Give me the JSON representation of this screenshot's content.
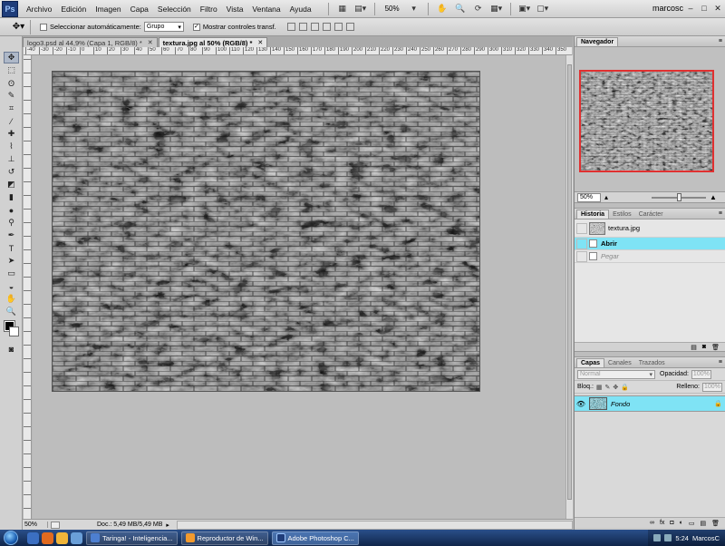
{
  "menu": [
    "Archivo",
    "Edición",
    "Imagen",
    "Capa",
    "Selección",
    "Filtro",
    "Vista",
    "Ventana",
    "Ayuda"
  ],
  "menubar": {
    "zoom": "50%",
    "user": "marcosc"
  },
  "options": {
    "auto_select_label": "Seleccionar automáticamente:",
    "auto_select_value": "Grupo",
    "transform_check": "✓",
    "transform_label": "Mostrar controles transf."
  },
  "tabs": [
    {
      "label": "logo3.psd al 44,9% (Capa 1, RGB/8) *",
      "active": false
    },
    {
      "label": "textura.jpg al 50% (RGB/8) *",
      "active": true
    }
  ],
  "ruler_labels": [
    "-40",
    "-30",
    "-20",
    "-10",
    "0",
    "10",
    "20",
    "30",
    "40",
    "50",
    "60",
    "70",
    "80",
    "90",
    "100",
    "110",
    "120",
    "130",
    "140",
    "150",
    "160",
    "170",
    "180",
    "190",
    "200",
    "210",
    "220",
    "230",
    "240",
    "250",
    "260",
    "270",
    "280",
    "290",
    "300",
    "310",
    "320",
    "330",
    "340",
    "350"
  ],
  "status": {
    "zoom": "50%",
    "doc": "Doc.: 5,49 MB/5,49 MB"
  },
  "navigator": {
    "tab": "Navegador",
    "zoom": "50%"
  },
  "history": {
    "tabs": [
      "Historia",
      "Estilos",
      "Carácter"
    ],
    "snapshot": "textura.jpg",
    "steps": [
      {
        "label": "Abrir",
        "state": "selected"
      },
      {
        "label": "Pegar",
        "state": "undone"
      }
    ]
  },
  "layers": {
    "tabs": [
      "Capas",
      "Canales",
      "Trazados"
    ],
    "blend_mode": "Normal",
    "opacity_label": "Opacidad:",
    "opacity": "100%",
    "lock_label": "Bloq.:",
    "fill_label": "Relleno:",
    "fill": "100%",
    "items": [
      {
        "name": "Fondo"
      }
    ]
  },
  "taskbar": {
    "buttons": [
      {
        "label": "Taringa! - Inteligencia...",
        "color": "#4d7fd0",
        "active": false
      },
      {
        "label": "Reproductor de Win...",
        "color": "#f29a2e",
        "active": false
      },
      {
        "label": "Adobe Photoshop C...",
        "color": "#1f3d7a",
        "active": true
      }
    ],
    "time": "5:24",
    "user": "MarcosC"
  },
  "colors": {
    "selection_highlight": "#7fe3f5",
    "nav_frame": "#e03030"
  }
}
